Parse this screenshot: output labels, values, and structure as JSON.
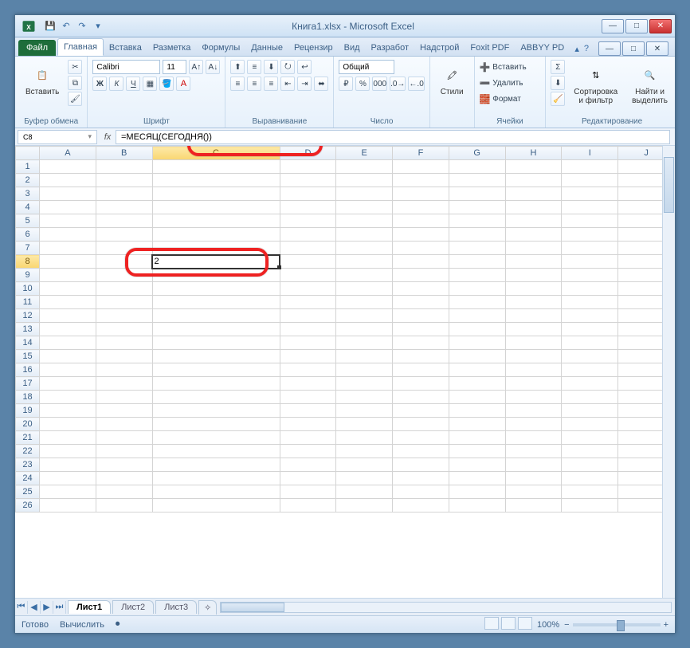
{
  "window": {
    "title": "Книга1.xlsx - Microsoft Excel"
  },
  "qat": {
    "save": "💾",
    "undo": "↶",
    "redo": "↷",
    "more": "▾"
  },
  "winbuttons": {
    "min": "—",
    "max": "□",
    "close": "✕",
    "min2": "—",
    "max2": "□",
    "close2": "✕"
  },
  "tabs": {
    "file": "Файл",
    "items": [
      "Главная",
      "Вставка",
      "Разметка",
      "Формулы",
      "Данные",
      "Рецензир",
      "Вид",
      "Разработ",
      "Надстрой",
      "Foxit PDF",
      "ABBYY PD"
    ],
    "active": 0,
    "help": "?"
  },
  "ribbon": {
    "clipboard": {
      "label": "Буфер обмена",
      "paste": "Вставить"
    },
    "font": {
      "label": "Шрифт",
      "name": "Calibri",
      "size": "11",
      "bold": "Ж",
      "italic": "К",
      "underline": "Ч"
    },
    "alignment": {
      "label": "Выравнивание"
    },
    "number": {
      "label": "Число",
      "format": "Общий"
    },
    "styles": {
      "label": "",
      "btn": "Стили"
    },
    "cells": {
      "label": "Ячейки",
      "insert": "Вставить",
      "delete": "Удалить",
      "format": "Формат"
    },
    "editing": {
      "label": "Редактирование",
      "sort": "Сортировка\nи фильтр",
      "find": "Найти и\nвыделить"
    }
  },
  "formula_bar": {
    "name": "C8",
    "fx": "fx",
    "formula": "=МЕСЯЦ(СЕГОДНЯ())"
  },
  "grid": {
    "columns": [
      "A",
      "B",
      "C",
      "D",
      "E",
      "F",
      "G",
      "H",
      "I",
      "J"
    ],
    "rows": 26,
    "active_col": "C",
    "active_row": 8,
    "cells": {
      "C8": "2"
    }
  },
  "sheets": {
    "tabs": [
      "Лист1",
      "Лист2",
      "Лист3"
    ],
    "active": 0,
    "add": "+"
  },
  "status": {
    "ready": "Готово",
    "calc": "Вычислить",
    "zoom": "100%",
    "minus": "−",
    "plus": "+"
  }
}
